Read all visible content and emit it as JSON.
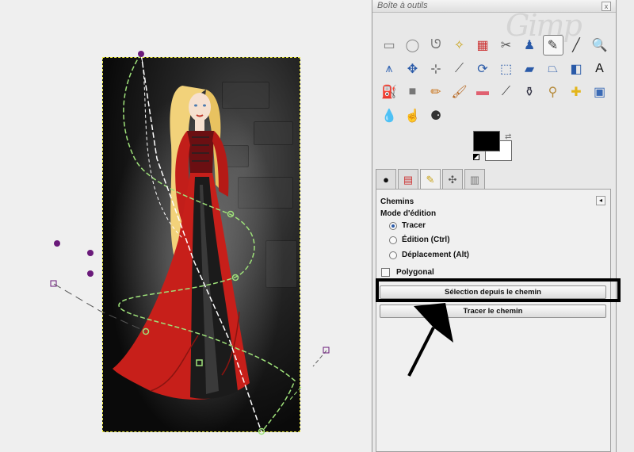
{
  "toolbox": {
    "title": "Boîte à outils",
    "close_glyph": "x",
    "watermark": "Gimp",
    "tools": [
      {
        "icon": "rect-select-icon",
        "glyph": "▭",
        "color": "#777"
      },
      {
        "icon": "ellipse-select-icon",
        "glyph": "◯",
        "color": "#888"
      },
      {
        "icon": "free-select-icon",
        "glyph": "ᘎ",
        "color": "#777"
      },
      {
        "icon": "fuzzy-select-icon",
        "glyph": "✧",
        "color": "#c9a31a"
      },
      {
        "icon": "color-select-icon",
        "glyph": "▦",
        "color": "#c33"
      },
      {
        "icon": "scissors-icon",
        "glyph": "✂",
        "color": "#555"
      },
      {
        "icon": "foreground-select-icon",
        "glyph": "♟",
        "color": "#2a5aa8"
      },
      {
        "icon": "paths-tool-icon",
        "glyph": "✎",
        "color": "#333",
        "active": true
      },
      {
        "icon": "color-picker-icon",
        "glyph": "╱",
        "color": "#333"
      },
      {
        "icon": "zoom-icon",
        "glyph": "🔍",
        "color": "#2a5aa8"
      },
      {
        "icon": "measure-icon",
        "glyph": "⩚",
        "color": "#3a6ab5"
      },
      {
        "icon": "move-icon",
        "glyph": "✥",
        "color": "#2a5aa8"
      },
      {
        "icon": "align-icon",
        "glyph": "⊹",
        "color": "#555"
      },
      {
        "icon": "crop-icon",
        "glyph": "⟋",
        "color": "#555"
      },
      {
        "icon": "rotate-icon",
        "glyph": "⟳",
        "color": "#2a5aa8"
      },
      {
        "icon": "scale-icon",
        "glyph": "⬚",
        "color": "#2a5aa8"
      },
      {
        "icon": "shear-icon",
        "glyph": "▰",
        "color": "#2a5aa8"
      },
      {
        "icon": "perspective-icon",
        "glyph": "⏢",
        "color": "#2a5aa8"
      },
      {
        "icon": "flip-icon",
        "glyph": "◧",
        "color": "#2a5aa8"
      },
      {
        "icon": "text-icon",
        "glyph": "A",
        "color": "#111"
      },
      {
        "icon": "bucket-fill-icon",
        "glyph": "⛽",
        "color": "#777"
      },
      {
        "icon": "blend-icon",
        "glyph": "■",
        "color": "#777"
      },
      {
        "icon": "pencil-icon",
        "glyph": "✏",
        "color": "#c9731a"
      },
      {
        "icon": "paintbrush-icon",
        "glyph": "🖌",
        "color": "#b5651d"
      },
      {
        "icon": "eraser-icon",
        "glyph": "▬",
        "color": "#e06070"
      },
      {
        "icon": "airbrush-icon",
        "glyph": "⟋",
        "color": "#444"
      },
      {
        "icon": "ink-icon",
        "glyph": "⚱",
        "color": "#334"
      },
      {
        "icon": "clone-icon",
        "glyph": "⚲",
        "color": "#b58a3a"
      },
      {
        "icon": "heal-icon",
        "glyph": "✚",
        "color": "#e3b51a"
      },
      {
        "icon": "perspective-clone-icon",
        "glyph": "▣",
        "color": "#3a6ab5"
      },
      {
        "icon": "blur-icon",
        "glyph": "💧",
        "color": "#3a6ab5"
      },
      {
        "icon": "smudge-icon",
        "glyph": "☝",
        "color": "#c9731a"
      },
      {
        "icon": "dodge-burn-icon",
        "glyph": "⚈",
        "color": "#333"
      }
    ],
    "tabs": [
      "tool-options-tab",
      "devices-tab",
      "paths-tab",
      "undo-tab",
      "images-tab"
    ]
  },
  "panel": {
    "title": "Chemins",
    "menu_glyph": "◂",
    "mode_label": "Mode d'édition",
    "modes": [
      {
        "label": "Tracer",
        "selected": true
      },
      {
        "label": "Édition (Ctrl)",
        "selected": false
      },
      {
        "label": "Déplacement (Alt)",
        "selected": false
      }
    ],
    "polygonal_label": "Polygonal",
    "polygonal_checked": false,
    "selection_button": "Sélection depuis le chemin",
    "stroke_button": "Tracer le chemin"
  },
  "colors": {
    "foreground": "#000000",
    "background": "#ffffff",
    "path_stroke": "#ffffff",
    "path_green": "#9fe27a",
    "anchor_purple": "#6a1a7a",
    "selection_border": "#e8e640"
  }
}
